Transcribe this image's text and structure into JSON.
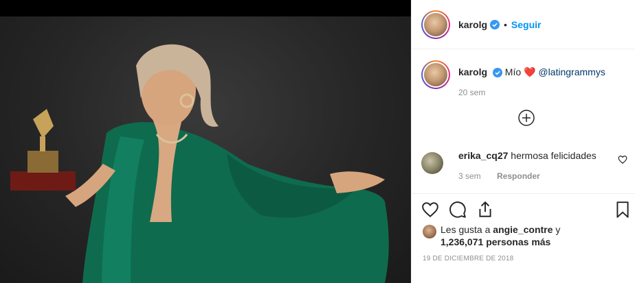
{
  "header": {
    "username": "karolg",
    "separator": "•",
    "follow_label": "Seguir"
  },
  "caption": {
    "username": "karolg",
    "text": "Mío",
    "emoji": "❤️",
    "mention": "@latingrammys",
    "time": "20 sem"
  },
  "comments": [
    {
      "username": "erika_cq27",
      "text": "hermosa felicidades",
      "time": "3 sem",
      "reply_label": "Responder"
    }
  ],
  "likes": {
    "prefix": "Les gusta a",
    "user": "angie_contre",
    "conjunction": "y",
    "count": "1,236,071",
    "suffix": "personas más"
  },
  "post_date": "19 DE DICIEMBRE DE 2018",
  "icons": {
    "verified": "verified-badge-icon",
    "load_more": "plus-circle-icon",
    "like": "heart-icon",
    "comment": "comment-icon",
    "share": "share-icon",
    "save": "bookmark-icon"
  },
  "colors": {
    "accent": "#0095f6",
    "verified": "#3897f0",
    "dress": "#0f6b4e",
    "background_photo": "#262626"
  }
}
